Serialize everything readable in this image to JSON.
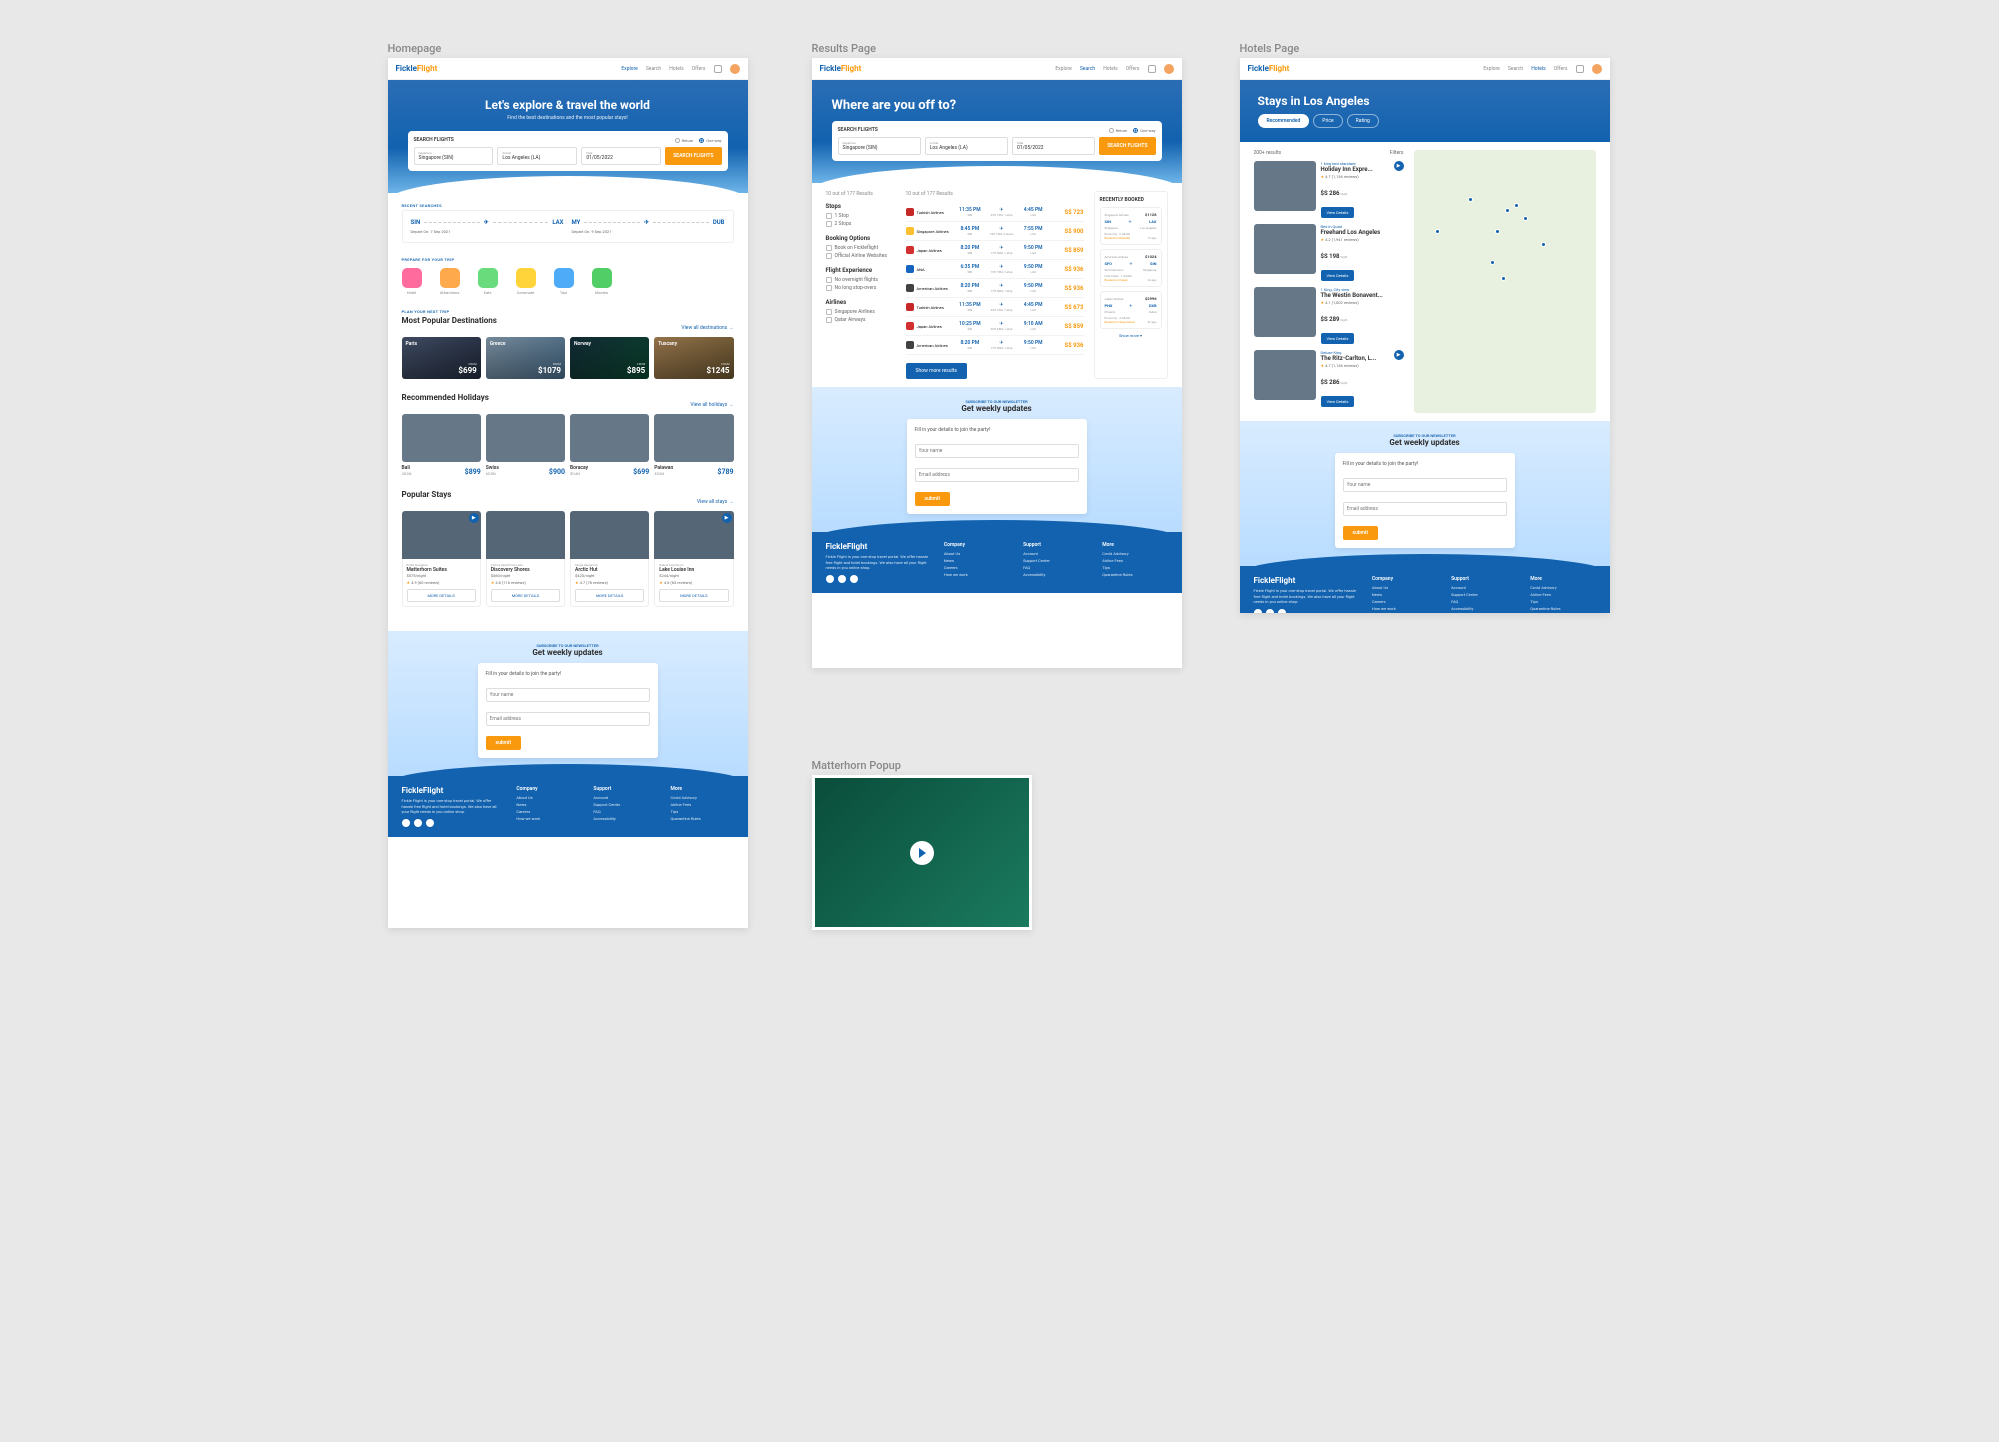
{
  "labels": {
    "home": "Homepage",
    "results": "Results Page",
    "hotels": "Hotels Page",
    "popup": "Matterhorn Popup"
  },
  "brand": {
    "a": "Fickle",
    "b": "Flight"
  },
  "nav": {
    "explore": "Explore",
    "search": "Search",
    "hotels": "Hotels",
    "offers": "Offers"
  },
  "home": {
    "heroTitle": "Let's explore & travel the world",
    "heroSub": "Find the best destinations and the most popular stays!",
    "searchLabel": "SEARCH FLIGHTS",
    "return": "Return",
    "oneway": "One-way",
    "dep": {
      "lb": "Departure",
      "vl": "Singapore (SIN)"
    },
    "arr": {
      "lb": "Arrival",
      "vl": "Los Angeles (LA)"
    },
    "date": {
      "lb": "Date",
      "vl": "01/05/2022"
    },
    "searchBtn": "SEARCH FLIGHTS",
    "recentTitle": "RECENT SEARCHES",
    "recent": [
      {
        "from": "SIN",
        "to": "LAX",
        "date": "Depart On: 7 Sep 2021"
      },
      {
        "from": "MY",
        "to": "DUB",
        "date": "Depart On: 9 Sep 2021"
      }
    ],
    "prepEyebrow": "PREPARE FOR YOUR TRIP",
    "tiles": [
      {
        "l": "Hotel",
        "c": "#ff6b9d"
      },
      {
        "l": "Attractions",
        "c": "#ffa94d"
      },
      {
        "l": "Eats",
        "c": "#69db7c"
      },
      {
        "l": "Commute",
        "c": "#ffd43b"
      },
      {
        "l": "Taxi",
        "c": "#4dabf7"
      },
      {
        "l": "Movies",
        "c": "#51cf66"
      }
    ],
    "destEyebrow": "PLAN YOUR NEXT TRIP",
    "destTitle": "Most Popular Destinations",
    "destLink": "View all destinations →",
    "dests": [
      {
        "nm": "Paris",
        "pr": "$699",
        "bg": "bg-paris"
      },
      {
        "nm": "Greece",
        "pr": "$1079",
        "bg": "bg-greece"
      },
      {
        "nm": "Norway",
        "pr": "$895",
        "bg": "bg-norway"
      },
      {
        "nm": "Tuscany",
        "pr": "$1245",
        "bg": "bg-tuscany"
      }
    ],
    "holTitle": "Recommended Holidays",
    "holLink": "View all holidays →",
    "hols": [
      {
        "nm": "Bali",
        "sub": "4D3N",
        "pr": "$899",
        "bg": "bg-bali"
      },
      {
        "nm": "Swiss",
        "sub": "6D5N",
        "pr": "$900",
        "bg": "bg-swiss"
      },
      {
        "nm": "Boracay",
        "sub": "5D4N",
        "pr": "$699",
        "bg": "bg-boracay"
      },
      {
        "nm": "Palawan",
        "sub": "4D3N",
        "pr": "$789",
        "bg": "bg-palawan"
      }
    ],
    "stayTitle": "Popular Stays",
    "stayLink": "View all stays →",
    "stays": [
      {
        "ty": "Entire bungalow",
        "nm": "Matterhorn Suites",
        "pr": "$575/night",
        "rt": "4.9",
        "rv": "(60 reviews)",
        "bg": "bg-matter",
        "vid": true
      },
      {
        "ty": "2-Story beachfront suite",
        "nm": "Discovery Shores",
        "pr": "$360/night",
        "rt": "4.8",
        "rv": "(116 reviews)",
        "bg": "bg-disc"
      },
      {
        "ty": "Single deluxe hut",
        "nm": "Arctic Hut",
        "pr": "$420/night",
        "rt": "4.7",
        "rv": "(78 reviews)",
        "bg": "bg-arctic"
      },
      {
        "ty": "Deluxe King Room",
        "nm": "Lake Louise Inn",
        "pr": "$244/night",
        "rt": "4.6",
        "rv": "(63 reviews)",
        "bg": "bg-lake",
        "vid": true
      }
    ],
    "stayBtn": "MORE DETAILS"
  },
  "results": {
    "heroTitle": "Where are you off to?",
    "hint": "10 out of 177 Results",
    "filters": {
      "stops": {
        "h": "Stops",
        "opts": [
          "1 Stop",
          "2 Stops"
        ]
      },
      "booking": {
        "h": "Booking Options",
        "opts": [
          "Book on Fickleflight",
          "Official Airline Websites"
        ]
      },
      "exp": {
        "h": "Flight Experience",
        "opts": [
          "No overnight flights",
          "No long stop-overs"
        ]
      },
      "air": {
        "h": "Airlines",
        "opts": [
          "Singapore Airlines",
          "Qatar Airways"
        ]
      }
    },
    "flights": [
      {
        "air": "Turkish Airlines",
        "c": "#c62828",
        "dep": "11:35 PM",
        "dc": "SIN",
        "arr": "4:45 PM",
        "ac": "LAX",
        "dur": "33H 10M, 1-stop",
        "pr": "S$ 723"
      },
      {
        "air": "Singapore Airlines",
        "c": "#fbc02d",
        "dep": "8:45 PM",
        "dc": "SIN",
        "arr": "7:55 PM",
        "ac": "LAX",
        "dur": "15H 10M, 2-stops",
        "pr": "S$ 900"
      },
      {
        "air": "Japan Airlines",
        "c": "#d32f2f",
        "dep": "8:20 PM",
        "dc": "SIN",
        "arr": "9:50 PM",
        "ac": "LAX",
        "dur": "17H 30M, 1-stop",
        "pr": "S$ 859"
      },
      {
        "air": "ANA",
        "c": "#1565c0",
        "dep": "6:35 PM",
        "dc": "SIN",
        "arr": "9:50 PM",
        "ac": "LAX",
        "dur": "19H 15M, 1-stop",
        "pr": "S$ 936"
      },
      {
        "air": "American Airlines",
        "c": "#424242",
        "dep": "8:20 PM",
        "dc": "SIN",
        "arr": "9:50 PM",
        "ac": "LAX",
        "dur": "17H 30M, 1-stop",
        "pr": "S$ 936"
      },
      {
        "air": "Turkish Airlines",
        "c": "#c62828",
        "dep": "11:35 PM",
        "dc": "SIN",
        "arr": "4:45 PM",
        "ac": "LAX",
        "dur": "33H 10M, 1-stop",
        "pr": "S$ 673"
      },
      {
        "air": "Japan Airlines",
        "c": "#d32f2f",
        "dep": "10:25 PM",
        "dc": "SIN",
        "arr": "9:10 AM",
        "ac": "LAX",
        "dur": "26H 45M, 1-stop",
        "pr": "S$ 859"
      },
      {
        "air": "American Airlines",
        "c": "#424242",
        "dep": "8:20 PM",
        "dc": "SIN",
        "arr": "9:50 PM",
        "ac": "LAX",
        "dur": "17H 30M, 1-stop",
        "pr": "S$ 936"
      }
    ],
    "showMore": "Show more results",
    "bookedTitle": "RECENTLY BOOKED",
    "booked": [
      {
        "air": "Singapore Airlines",
        "from": "SIN",
        "to": "LAX",
        "fl": "Singapore",
        "tl": "Los Angeles",
        "pr": "$1128",
        "cls": "Economy",
        "n": "2 Adults",
        "exp": "Expedia",
        "d": "1s ago"
      },
      {
        "air": "American Airlines",
        "from": "SFO",
        "to": "SIN",
        "fl": "San Francisco",
        "tl": "Singapore",
        "pr": "$1024",
        "cls": "First Class",
        "n": "1 Adults",
        "exp": "Kayak",
        "d": "2s ago"
      },
      {
        "air": "Japan Airlines",
        "from": "PHX",
        "to": "DXB",
        "fl": "Phoenix",
        "tl": "Dubai",
        "pr": "$2996",
        "cls": "Economy",
        "n": "3 Adults",
        "exp": "Skyscanner",
        "d": "3s ago"
      }
    ],
    "showMore2": "Show more ▾"
  },
  "hotels": {
    "title": "Stays in Los Angeles",
    "pills": [
      "Recommended",
      "Price",
      "Rating"
    ],
    "count": "200+ results",
    "filters": "Filters",
    "list": [
      {
        "ty": "1 king bed standard",
        "nm": "Holiday Inn Expre...",
        "rt": "4.7",
        "rv": "(1,136 reviews)",
        "pr": "$S 286",
        "pn": "/night",
        "bg": "bg-h1",
        "vid": true
      },
      {
        "ty": "Bed in Quad",
        "nm": "Freehand Los Angeles",
        "rt": "4.2",
        "rv": "(1,941 reviews)",
        "pr": "$S 198",
        "pn": "/night",
        "bg": "bg-h2"
      },
      {
        "ty": "1 King, City view",
        "nm": "The Westin Bonavent...",
        "rt": "4.1",
        "rv": "(1,002 reviews)",
        "pr": "$S 289",
        "pn": "/night",
        "bg": "bg-h3"
      },
      {
        "ty": "Deluxe King",
        "nm": "The Ritz-Carlton, L...",
        "rt": "4.7",
        "rv": "(1,136 reviews)",
        "pr": "$S 286",
        "pn": "/night",
        "bg": "bg-h4",
        "vid": true
      }
    ],
    "viewBtn": "View Details"
  },
  "newsl": {
    "ey": "SUBSCRIBE TO OUR NEWSLETTER",
    "tt": "Get weekly updates",
    "h": "Fill in your details to join the party!",
    "name": "Your name",
    "email": "Email address",
    "btn": "submit"
  },
  "footer": {
    "desc": "Fickle Flight is your one-stop travel portal. We offer hassle free flight and hotel bookings. We also have all your flight needs in you online shop.",
    "cols": [
      {
        "h": "Company",
        "l": [
          "About Us",
          "News",
          "Careers",
          "How we work"
        ]
      },
      {
        "h": "Support",
        "l": [
          "Account",
          "Support Center",
          "FAQ",
          "Accessibility"
        ]
      },
      {
        "h": "More",
        "l": [
          "Covid Advisory",
          "Airline Fees",
          "Tips",
          "Quarantine Rules"
        ]
      }
    ]
  }
}
